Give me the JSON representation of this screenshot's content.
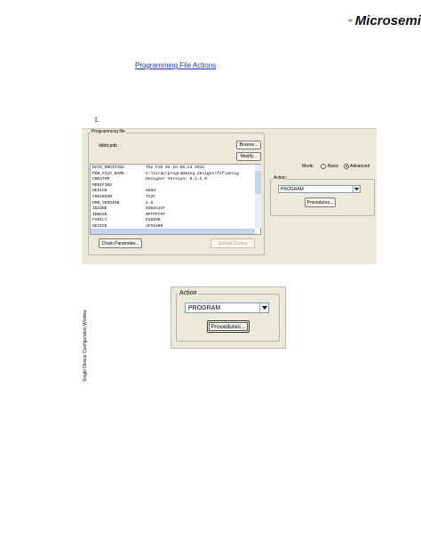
{
  "logo": {
    "text": "Microsemi",
    "icon": "microsemi-swirl-icon"
  },
  "doc": {
    "link_text": "Programming File Actions",
    "step_number": "1."
  },
  "dialog": {
    "side_label": "Single Device Configuration Window",
    "programming_file": {
      "group_title": "Programming file",
      "filename": "dddd.pdb",
      "browse_label": "Browse...",
      "modify_label": "Modify...",
      "rows": [
        {
          "key": "DATE_MODIFIED",
          "value": "Thu Feb 03 15:55:14 2011"
        },
        {
          "key": "PDB_FILE_NAME",
          "value": "V:\\hiran\\programming_designs\\fsf\\desig"
        },
        {
          "key": "CREATOR",
          "value": "Designer Version: 9.1.2.0"
        },
        {
          "key": "MODIFIED",
          "value": ""
        },
        {
          "key": "DESIGN",
          "value": "dddd"
        },
        {
          "key": "CHECKSUM",
          "value": "7C2F"
        },
        {
          "key": "PDB_VERSION",
          "value": "1.6"
        },
        {
          "key": "IDCODE",
          "value": "0352A1CF"
        },
        {
          "key": "IDMASK",
          "value": "0FFFFFFF"
        },
        {
          "key": "FAMILY",
          "value": "FUSION"
        },
        {
          "key": "DEVICE",
          "value": "AFS1500"
        }
      ],
      "chain_button": "Chain Parameter...",
      "unload_button": "Unload Device"
    },
    "mode": {
      "label": "Mode",
      "basic": "Basic",
      "advanced": "Advanced",
      "selected": "Advanced"
    },
    "action": {
      "group_title": "Action",
      "selected": "PROGRAM",
      "procedures_label": "Procedures..."
    }
  },
  "zoomed_action": {
    "group_title": "Action",
    "selected": "PROGRAM",
    "procedures_label": "Procedures..."
  }
}
